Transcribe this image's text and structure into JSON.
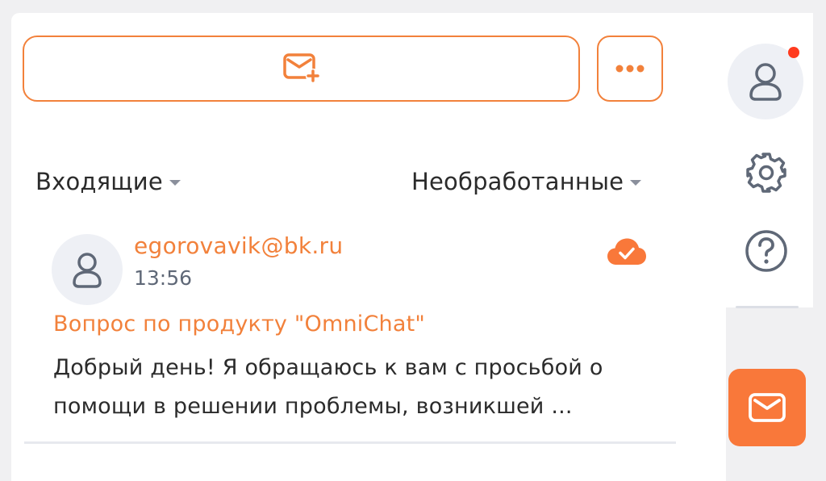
{
  "toolbar": {
    "compose_icon": "mail-plus-icon",
    "more_icon": "more-dots-icon"
  },
  "filters": {
    "folder": "Входящие",
    "status": "Необработанные"
  },
  "messages": [
    {
      "sender": "egorovavik@bk.ru",
      "time": "13:56",
      "subject": "Вопрос по продукту \"OmniChat\"",
      "preview": "Добрый день! Я обращаюсь к вам с просьбой о помощи в решении проблемы, возникшей ...",
      "status_icon": "cloud-check-icon"
    }
  ],
  "rail": {
    "profile_icon": "user-icon",
    "has_notification": true,
    "settings_icon": "gear-icon",
    "help_icon": "question-icon",
    "mail_icon": "mail-icon"
  },
  "colors": {
    "accent": "#f2813b",
    "notification": "#ff3b1f",
    "icon_gray": "#5f6877"
  }
}
